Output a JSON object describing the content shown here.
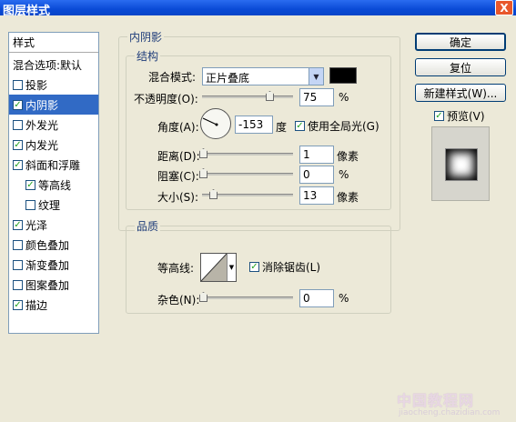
{
  "window": {
    "title": "图层样式",
    "close": "X"
  },
  "left_list": {
    "header": "样式",
    "items": [
      {
        "label": "混合选项:默认",
        "checkbox": false,
        "checked": false,
        "selected": false
      },
      {
        "label": "投影",
        "checkbox": true,
        "checked": false,
        "selected": false
      },
      {
        "label": "内阴影",
        "checkbox": true,
        "checked": true,
        "selected": true
      },
      {
        "label": "外发光",
        "checkbox": true,
        "checked": false,
        "selected": false
      },
      {
        "label": "内发光",
        "checkbox": true,
        "checked": true,
        "selected": false
      },
      {
        "label": "斜面和浮雕",
        "checkbox": true,
        "checked": true,
        "selected": false
      },
      {
        "label": "等高线",
        "checkbox": true,
        "checked": true,
        "selected": false,
        "indent": true
      },
      {
        "label": "纹理",
        "checkbox": true,
        "checked": false,
        "selected": false,
        "indent": true
      },
      {
        "label": "光泽",
        "checkbox": true,
        "checked": true,
        "selected": false
      },
      {
        "label": "颜色叠加",
        "checkbox": true,
        "checked": false,
        "selected": false
      },
      {
        "label": "渐变叠加",
        "checkbox": true,
        "checked": false,
        "selected": false
      },
      {
        "label": "图案叠加",
        "checkbox": true,
        "checked": false,
        "selected": false
      },
      {
        "label": "描边",
        "checkbox": true,
        "checked": true,
        "selected": false
      }
    ]
  },
  "inner_shadow": {
    "legend": "内阴影",
    "structure": {
      "legend": "结构",
      "blend_mode_label": "混合模式:",
      "blend_mode_value": "正片叠底",
      "color": "#000000",
      "opacity_label": "不透明度(O):",
      "opacity_value": "75",
      "opacity_unit": "%",
      "opacity_slider": 0.75,
      "angle_label": "角度(A):",
      "angle_value": "-153",
      "angle_unit": "度",
      "global_light_label": "使用全局光(G)",
      "global_light_checked": true,
      "distance_label": "距离(D):",
      "distance_value": "1",
      "distance_unit": "像素",
      "choke_label": "阻塞(C):",
      "choke_value": "0",
      "choke_unit": "%",
      "size_label": "大小(S):",
      "size_value": "13",
      "size_unit": "像素"
    },
    "quality": {
      "legend": "品质",
      "contour_label": "等高线:",
      "anti_alias_label": "消除锯齿(L)",
      "anti_alias_checked": true,
      "noise_label": "杂色(N):",
      "noise_value": "0",
      "noise_unit": "%"
    }
  },
  "buttons": {
    "ok": "确定",
    "reset": "复位",
    "new_style": "新建样式(W)...",
    "preview_label": "预览(V)",
    "preview_checked": true
  },
  "watermark": {
    "line1": "中国教程网",
    "line2": "jiaocheng.chazidian.com"
  },
  "colors": {
    "title_bar": "#0a4ad6",
    "selection": "#316ac5",
    "check": "#21a121"
  },
  "icons": {
    "close": "close-icon",
    "dropdown": "chevron-down-icon",
    "check": "checkmark-icon"
  }
}
